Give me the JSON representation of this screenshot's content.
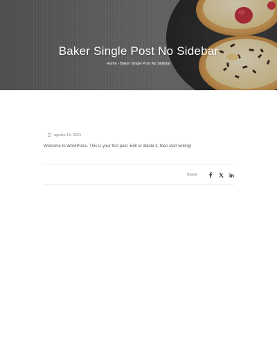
{
  "hero": {
    "title": "Baker Single Post No Sidebar",
    "breadcrumb": {
      "home": "Home",
      "separator": "›",
      "current": "Baker Single Post No Sidebar"
    }
  },
  "post": {
    "date": "agosto 13, 2021",
    "content": "Welcome to WordPress. This is your first post. Edit or delete it, then start writing!"
  },
  "share": {
    "label": "Share:",
    "icons": [
      "facebook-icon",
      "x-twitter-icon",
      "linkedin-icon"
    ]
  },
  "colors": {
    "hero_text": "#ffffff",
    "body_text": "#555555",
    "divider": "#eeeeee"
  }
}
